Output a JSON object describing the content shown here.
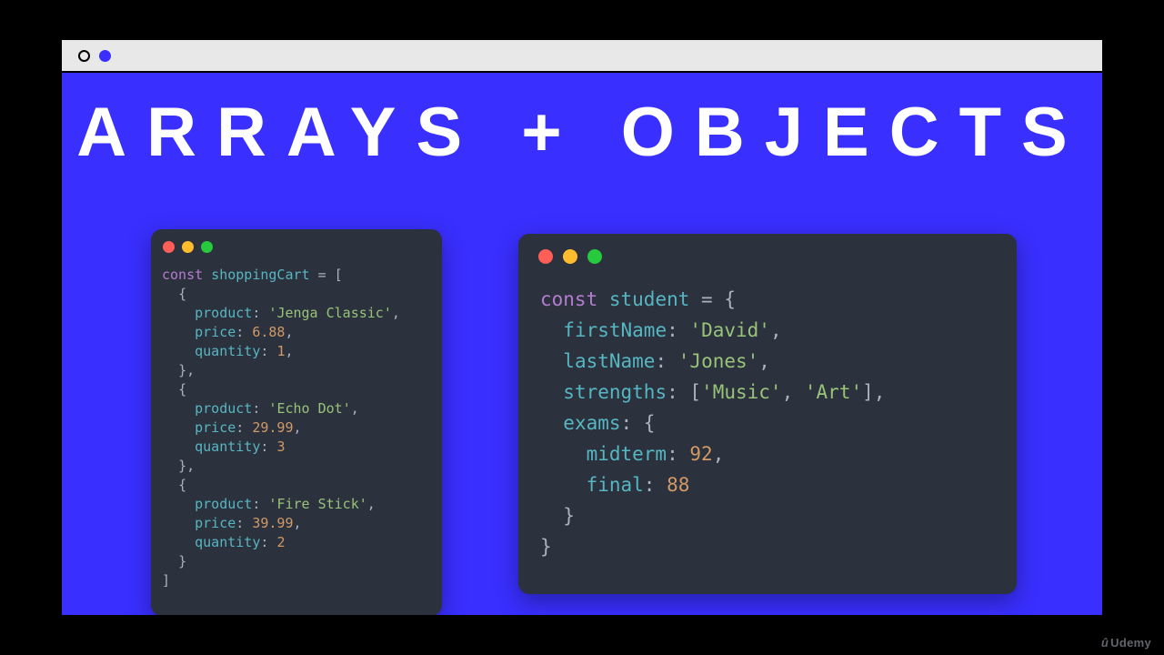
{
  "slide": {
    "title": "ARRAYS + OBJECTS"
  },
  "left": {
    "traffic": [
      "red",
      "yellow",
      "green"
    ],
    "const": "const",
    "varname": "shoppingCart",
    "items": [
      {
        "product_key": "product",
        "product": "Jenga Classic",
        "price_key": "price",
        "price": "6.88",
        "qty_key": "quantity",
        "qty": "1"
      },
      {
        "product_key": "product",
        "product": "Echo Dot",
        "price_key": "price",
        "price": "29.99",
        "qty_key": "quantity",
        "qty": "3"
      },
      {
        "product_key": "product",
        "product": "Fire Stick",
        "price_key": "price",
        "price": "39.99",
        "qty_key": "quantity",
        "qty": "2"
      }
    ]
  },
  "right": {
    "traffic": [
      "red",
      "yellow",
      "green"
    ],
    "const": "const",
    "varname": "student",
    "k_firstName": "firstName",
    "v_firstName": "David",
    "k_lastName": "lastName",
    "v_lastName": "Jones",
    "k_strengths": "strengths",
    "v_strength_0": "Music",
    "v_strength_1": "Art",
    "k_exams": "exams",
    "k_midterm": "midterm",
    "v_midterm": "92",
    "k_final": "final",
    "v_final": "88"
  },
  "watermark": "Udemy"
}
